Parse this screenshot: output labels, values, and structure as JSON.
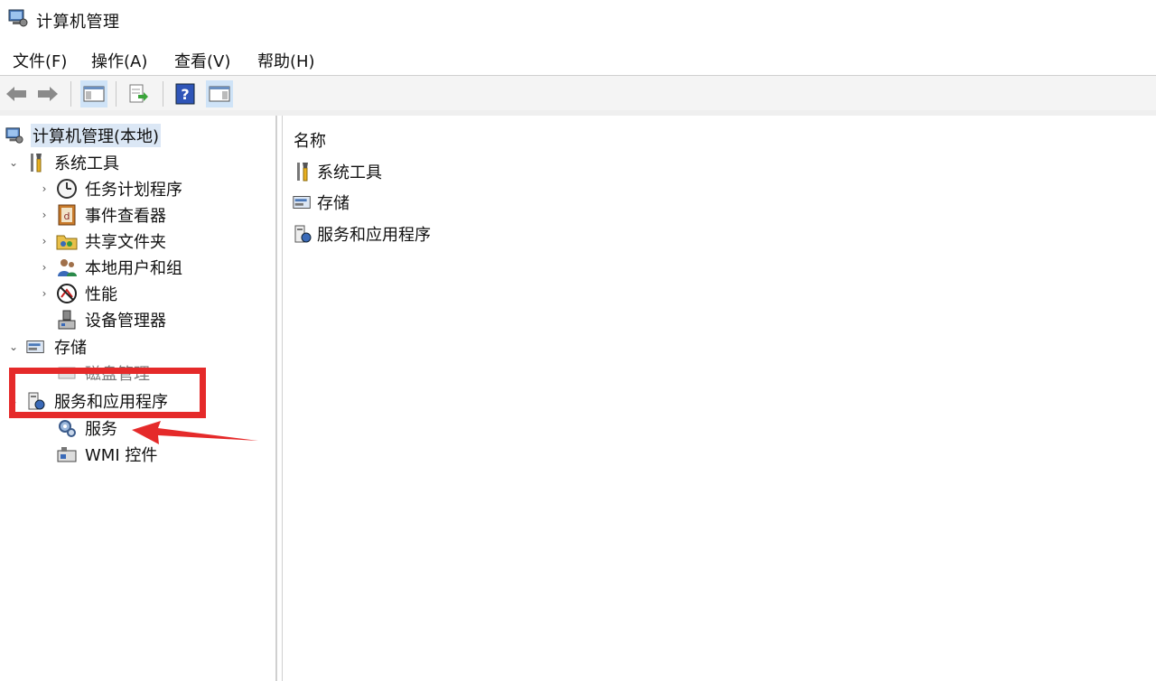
{
  "window": {
    "title": "计算机管理"
  },
  "menu": {
    "items": [
      {
        "label": "文件(F)"
      },
      {
        "label": "操作(A)"
      },
      {
        "label": "查看(V)"
      },
      {
        "label": "帮助(H)"
      }
    ]
  },
  "toolbar": {
    "buttons": [
      "back-arrow-icon",
      "forward-arrow-icon",
      "show-hide-console-tree-icon",
      "export-list-icon",
      "help-icon",
      "show-hide-action-pane-icon"
    ]
  },
  "tree": {
    "root": {
      "label": "计算机管理(本地)",
      "icon": "computer-management-icon"
    },
    "system_tools": {
      "label": "系统工具",
      "icon": "tools-icon",
      "expanded": true,
      "children": [
        {
          "label": "任务计划程序",
          "icon": "clock-icon"
        },
        {
          "label": "事件查看器",
          "icon": "event-viewer-icon"
        },
        {
          "label": "共享文件夹",
          "icon": "shared-folder-icon"
        },
        {
          "label": "本地用户和组",
          "icon": "users-icon"
        },
        {
          "label": "性能",
          "icon": "performance-icon"
        },
        {
          "label": "设备管理器",
          "icon": "device-manager-icon"
        }
      ]
    },
    "storage": {
      "label": "存储",
      "icon": "storage-icon",
      "expanded": true,
      "children": [
        {
          "label": "磁盘管理",
          "icon": "disk-icon"
        }
      ]
    },
    "services_apps": {
      "label": "服务和应用程序",
      "icon": "services-apps-icon",
      "expanded": true,
      "children": [
        {
          "label": "服务",
          "icon": "services-gear-icon"
        },
        {
          "label": "WMI 控件",
          "icon": "wmi-icon"
        }
      ]
    }
  },
  "content": {
    "column_header": "名称",
    "rows": [
      {
        "label": "系统工具",
        "icon": "tools-icon"
      },
      {
        "label": "存储",
        "icon": "storage-icon"
      },
      {
        "label": "服务和应用程序",
        "icon": "services-apps-icon"
      }
    ]
  },
  "annotation": {
    "box_color": "#e52a2a",
    "arrow_color": "#e52a2a"
  }
}
